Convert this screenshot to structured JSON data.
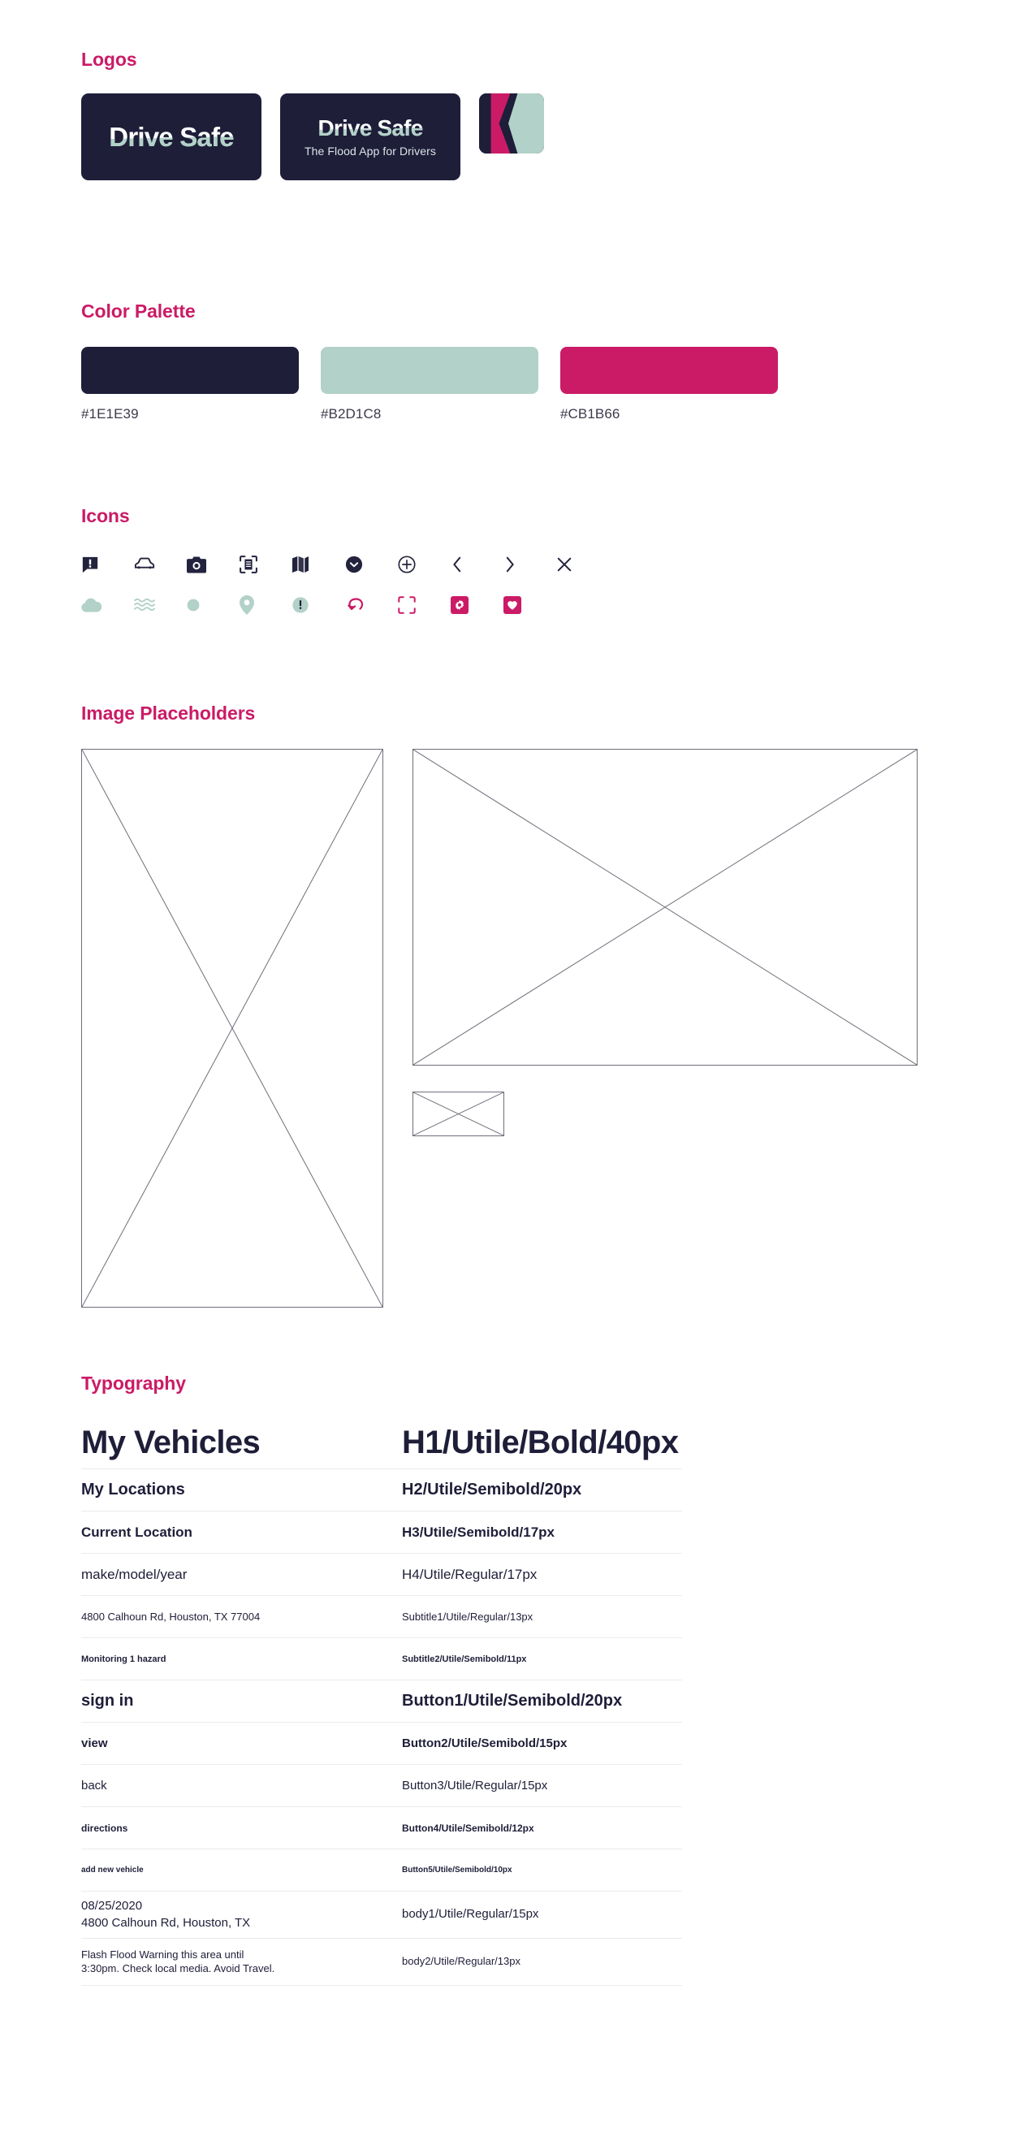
{
  "sections": {
    "logos": "Logos",
    "palette": "Color Palette",
    "icons": "Icons",
    "placeholders": "Image Placeholders",
    "typography": "Typography"
  },
  "logos": {
    "primary": {
      "wordmark": "Drive Safe"
    },
    "with_tagline": {
      "wordmark": "Drive Safe",
      "tagline": "The Flood App for Drivers"
    },
    "app_mark": {
      "label": "app-mark"
    }
  },
  "palette": [
    {
      "hex": "#1E1E39",
      "label": "#1E1E39"
    },
    {
      "hex": "#B2D1C8",
      "label": "#B2D1C8"
    },
    {
      "hex": "#CB1B66",
      "label": "#CB1B66"
    }
  ],
  "icons": {
    "row1_color": "#23233E",
    "row1": [
      "alert-message-icon",
      "car-icon",
      "camera-icon",
      "scan-document-icon",
      "map-icon",
      "chevron-down-circle-icon",
      "plus-circle-icon",
      "chevron-left-icon",
      "chevron-right-icon",
      "close-icon"
    ],
    "row2": [
      {
        "name": "cloud-icon",
        "color": "#B2D1C8"
      },
      {
        "name": "waves-icon",
        "color": "#B2D1C8"
      },
      {
        "name": "dot-icon",
        "color": "#B2D1C8"
      },
      {
        "name": "map-pin-icon",
        "color": "#B2D1C8"
      },
      {
        "name": "alert-circle-icon",
        "color": "#B2D1C8"
      },
      {
        "name": "reroute-arrow-icon",
        "color": "#CB1B66"
      },
      {
        "name": "scan-corners-icon",
        "color": "#CB1B66"
      },
      {
        "name": "settings-gear-icon",
        "color": "#CB1B66"
      },
      {
        "name": "heart-icon",
        "color": "#CB1B66"
      }
    ]
  },
  "placeholders": [
    {
      "name": "tall-portrait-placeholder"
    },
    {
      "name": "wide-landscape-placeholder"
    },
    {
      "name": "small-thumbnail-placeholder"
    }
  ],
  "typography": [
    {
      "sample": "My Vehicles",
      "spec": "H1/Utile/Bold/40px",
      "style": "h1"
    },
    {
      "sample": "My Locations",
      "spec": "H2/Utile/Semibold/20px",
      "style": "h2"
    },
    {
      "sample": "Current Location",
      "spec": "H3/Utile/Semibold/17px",
      "style": "h3"
    },
    {
      "sample": "make/model/year",
      "spec": "H4/Utile/Regular/17px",
      "style": "h4"
    },
    {
      "sample": "4800 Calhoun Rd, Houston, TX 77004",
      "spec": "Subtitle1/Utile/Regular/13px",
      "style": "sub1"
    },
    {
      "sample": "Monitoring 1 hazard",
      "spec": "Subtitle2/Utile/Semibold/11px",
      "style": "sub2"
    },
    {
      "sample": "sign in",
      "spec": "Button1/Utile/Semibold/20px",
      "style": "btn1"
    },
    {
      "sample": "view",
      "spec": "Button2/Utile/Semibold/15px",
      "style": "btn2"
    },
    {
      "sample": "back",
      "spec": "Button3/Utile/Regular/15px",
      "style": "btn3"
    },
    {
      "sample": "directions",
      "spec": "Button4/Utile/Semibold/12px",
      "style": "btn4"
    },
    {
      "sample": "add new vehicle",
      "spec": "Button5/Utile/Semibold/10px",
      "style": "btn5"
    },
    {
      "sample": "08/25/2020\n4800 Calhoun Rd, Houston, TX",
      "spec": "body1/Utile/Regular/15px",
      "style": "body1"
    },
    {
      "sample": "Flash Flood Warning this area until\n3:30pm. Check local media. Avoid Travel.",
      "spec": "body2/Utile/Regular/13px",
      "style": "body2"
    }
  ]
}
